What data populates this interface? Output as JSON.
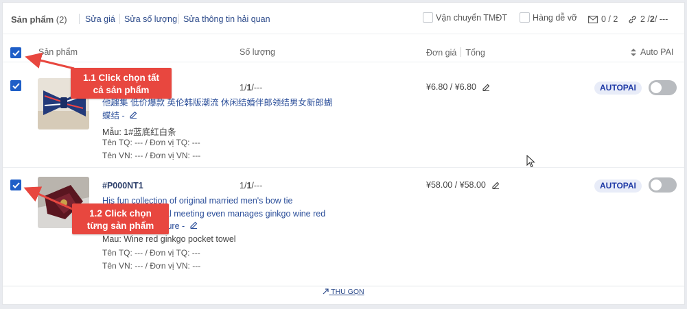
{
  "header": {
    "title": "Sản phẩm",
    "count": "(2)",
    "links": [
      "Sửa giá",
      "Sửa số lượng",
      "Sửa thông tin hải quan"
    ],
    "checks": [
      "Vận chuyển TMĐT",
      "Hàng dễ vỡ"
    ],
    "mail_count": "0 / 2",
    "link_count_a": "2 / ",
    "link_count_b": "2",
    "link_count_c": " / ---"
  },
  "columns": {
    "product": "Sản phẩm",
    "quantity": "Số lượng",
    "unit_price": "Đơn giá",
    "total": "Tổng",
    "auto_pai": "Auto PAI"
  },
  "rows": [
    {
      "code": "",
      "name_line1": "他趣集 低价爆款 英伦韩版潮流 休闲结婚伴郎领结男女新郎蝴",
      "name_line2": "蝶结 -",
      "variant": "Mẫu: 1#蓝底红白条",
      "meta_tq": "Tên TQ: ---  /  Đơn vị TQ: ---",
      "meta_vn": "Tên VN: ---  /  Đơn vị VN: ---",
      "qty_a": "1/",
      "qty_b": "1",
      "qty_c": "/---",
      "price": "¥6.80 / ¥6.80",
      "badge": "AUTOPAI"
    },
    {
      "code": "#P000NT1",
      "name_line1": "His fun collection of original married men's bow tie",
      "name_line2": "al meeting even manages ginkgo wine red",
      "name_line3": "ture -",
      "variant": "Mau: Wine red ginkgo pocket towel",
      "meta_tq": "Tên TQ: ---  /  Đơn vị TQ: ---",
      "meta_vn": "Tên VN: ---  /  Đơn vị VN: ---",
      "qty_a": "1/",
      "qty_b": "1",
      "qty_c": "/---",
      "price": "¥58.00 / ¥58.00",
      "badge": "AUTOPAI"
    }
  ],
  "footer": {
    "collapse": "THU GỌN"
  },
  "callouts": {
    "c1_line1": "1.1  Click chọn tất",
    "c1_line2": "cả sản phẩm",
    "c2_line1": "1.2  Click chọn",
    "c2_line2": "từng sản phẩm"
  },
  "colors": {
    "accent": "#1e5ec7",
    "callout": "#e8473f",
    "badge_text": "#1f3aa6"
  }
}
